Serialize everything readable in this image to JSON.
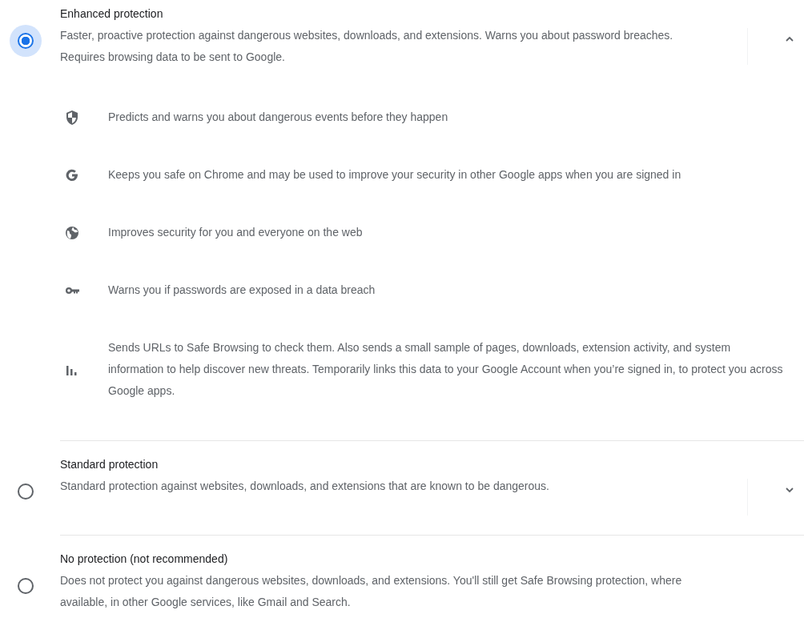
{
  "options": [
    {
      "title": "Enhanced protection",
      "description": "Faster, proactive protection against dangerous websites, downloads, and extensions. Warns you about password breaches. Requires browsing data to be sent to Google.",
      "selected": true,
      "kind": "expandable",
      "expanded": true,
      "features": [
        {
          "kind": "shield",
          "text": "Predicts and warns you about dangerous events before they happen"
        },
        {
          "kind": "g",
          "text": "Keeps you safe on Chrome and may be used to improve your security in other Google apps when you are signed in"
        },
        {
          "kind": "globe",
          "text": "Improves security for you and everyone on the web"
        },
        {
          "kind": "key",
          "text": "Warns you if passwords are exposed in a data breach"
        },
        {
          "kind": "chart",
          "text": "Sends URLs to Safe Browsing to check them. Also sends a small sample of pages, downloads, extension activity, and system information to help discover new threats. Temporarily links this data to your Google Account when you’re signed in, to protect you across Google apps."
        }
      ]
    },
    {
      "title": "Standard protection",
      "description": "Standard protection against websites, downloads, and extensions that are known to be dangerous.",
      "selected": false,
      "kind": "expandable",
      "expanded": false
    },
    {
      "title": "No protection (not recommended)",
      "description": "Does not protect you against dangerous websites, downloads, and extensions. You'll still get Safe Browsing protection, where available, in other Google services, like Gmail and Search.",
      "selected": false,
      "kind": "plain"
    }
  ]
}
